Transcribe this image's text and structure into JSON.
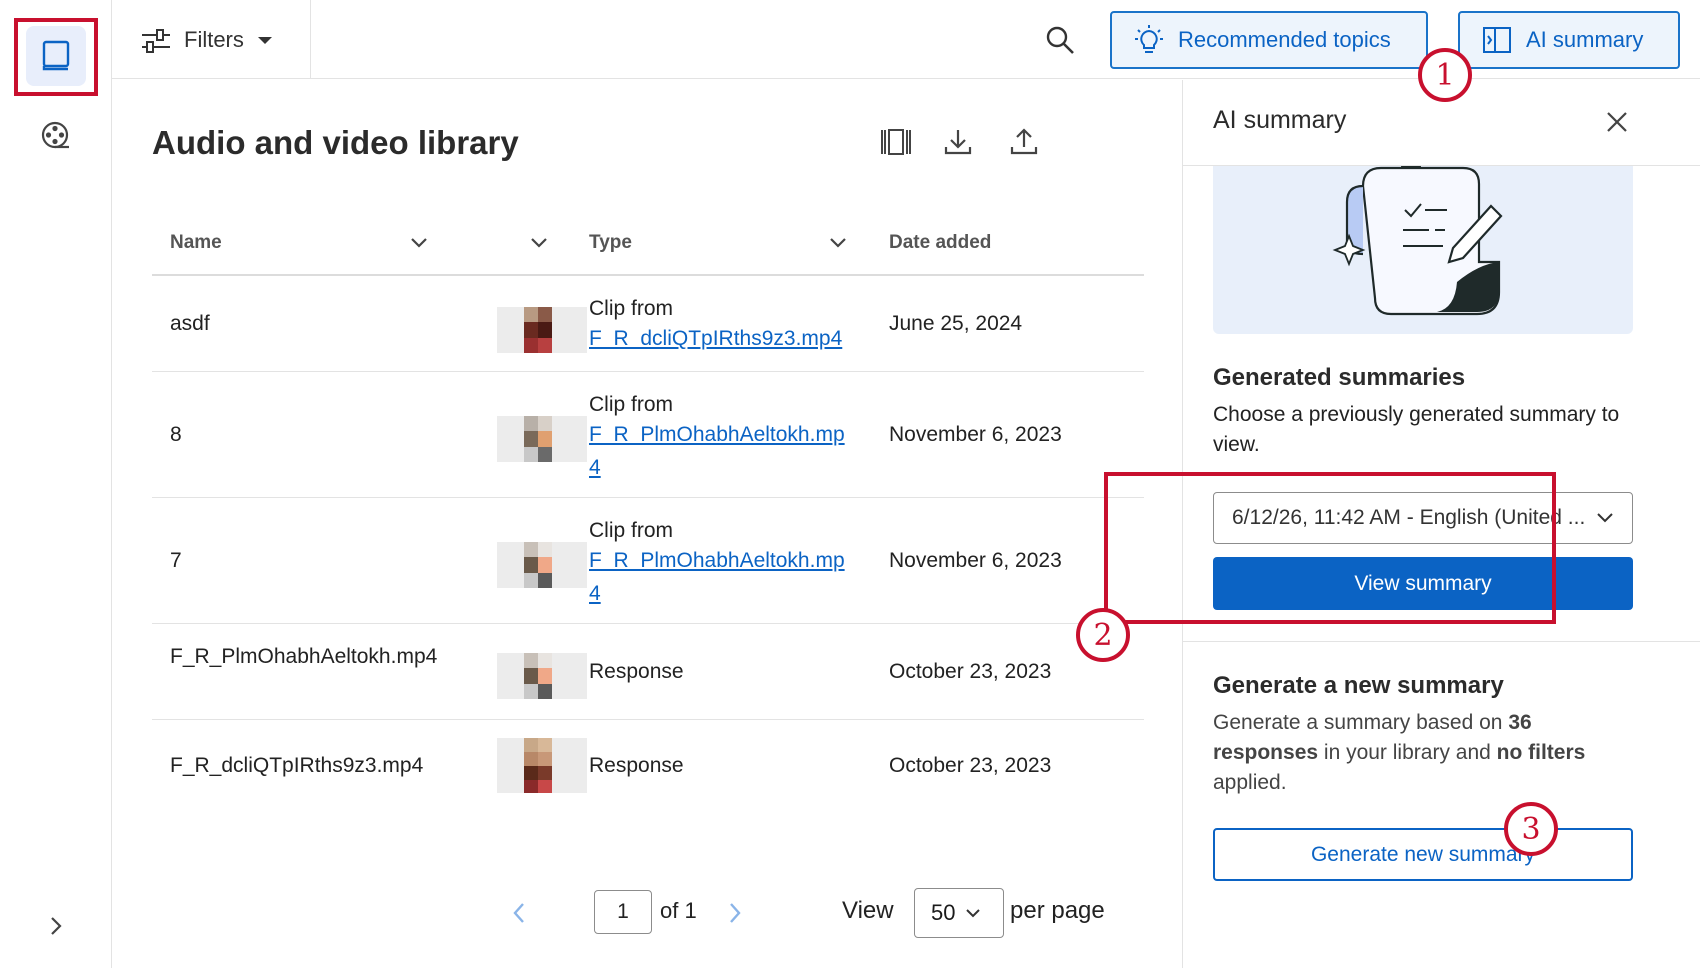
{
  "topbar": {
    "filters_label": "Filters",
    "recommended_label": "Recommended topics",
    "ai_summary_label": "AI summary"
  },
  "main": {
    "title": "Audio and video library",
    "columns": [
      "Name",
      "",
      "Type",
      "Date added"
    ],
    "rows": [
      {
        "name": "asdf",
        "type_text": "Clip from",
        "type_link": "F_R_dcliQTpIRths9z3.mp4",
        "date": "June 25, 2024"
      },
      {
        "name": "8",
        "type_text": "Clip from",
        "type_link": "F_R_PlmOhabhAeltokh.mp4",
        "date": "November 6, 2023"
      },
      {
        "name": "7",
        "type_text": "Clip from",
        "type_link": "F_R_PlmOhabhAeltokh.mp4",
        "date": "November 6, 2023"
      },
      {
        "name": "F_R_PlmOhabhAeltokh.mp4",
        "type_text": "Response",
        "type_link": "",
        "date": "October 23, 2023"
      },
      {
        "name": "F_R_dcliQTpIRths9z3.mp4",
        "type_text": "Response",
        "type_link": "",
        "date": "October 23, 2023"
      }
    ],
    "pagination": {
      "current_page": "1",
      "of_label": "of 1",
      "view_label": "View",
      "per_page_value": "50",
      "per_page_label": "per page"
    }
  },
  "panel": {
    "title": "AI summary",
    "generated_title": "Generated summaries",
    "generated_text": "Choose a previously generated summary to view.",
    "selected_summary": "6/12/26, 11:42 AM - English (United ...",
    "view_button": "View summary",
    "new_title": "Generate a new summary",
    "new_text_1": "Generate a summary based on ",
    "new_count": "36",
    "new_text_2": "responses",
    "new_text_3": " in your library and ",
    "new_text_4": "no filters",
    "new_text_5": " applied.",
    "generate_button": "Generate new summary"
  },
  "annotations": {
    "badge_1": "1",
    "badge_2": "2",
    "badge_3": "3"
  },
  "colors": {
    "accent": "#0b63c4",
    "highlight": "#c8102e"
  }
}
